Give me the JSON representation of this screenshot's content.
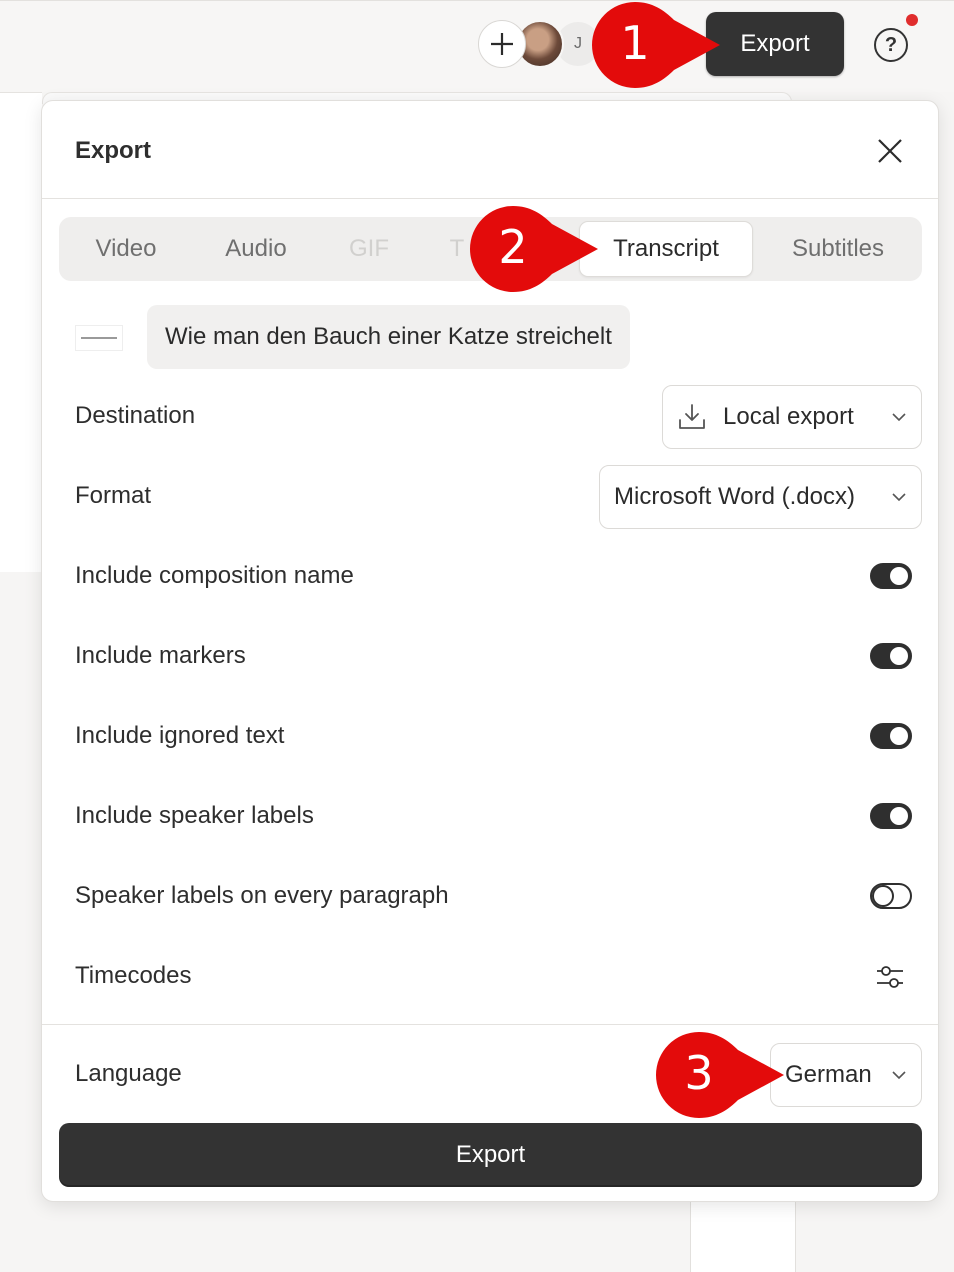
{
  "topbar": {
    "add_label": "+",
    "avatar_initial": "J",
    "export_label": "Export",
    "help_label": "?"
  },
  "dialog": {
    "title": "Export",
    "tabs": [
      {
        "label": "Video",
        "state": "normal"
      },
      {
        "label": "Audio",
        "state": "normal"
      },
      {
        "label": "GIF",
        "state": "disabled"
      },
      {
        "label": "T",
        "state": "disabled"
      },
      {
        "label": "Transcript",
        "state": "active"
      },
      {
        "label": "Subtitles",
        "state": "normal"
      }
    ],
    "composition_name": "Wie man den Bauch einer Katze streichelt",
    "destination": {
      "label": "Destination",
      "value": "Local export",
      "icon": "download-icon"
    },
    "format": {
      "label": "Format",
      "value": "Microsoft Word (.docx)"
    },
    "options": [
      {
        "label": "Include composition name",
        "on": true
      },
      {
        "label": "Include markers",
        "on": true
      },
      {
        "label": "Include ignored text",
        "on": true
      },
      {
        "label": "Include speaker labels",
        "on": true
      },
      {
        "label": "Speaker labels on every paragraph",
        "on": false
      }
    ],
    "timecodes": {
      "label": "Timecodes",
      "icon": "sliders-icon"
    },
    "language": {
      "label": "Language",
      "value": "German"
    },
    "export_button": "Export"
  },
  "callouts": [
    {
      "number": "1"
    },
    {
      "number": "2"
    },
    {
      "number": "3"
    }
  ],
  "colors": {
    "callout_red": "#e30b0b",
    "primary_dark": "#333333",
    "notification": "#e02d2d"
  }
}
